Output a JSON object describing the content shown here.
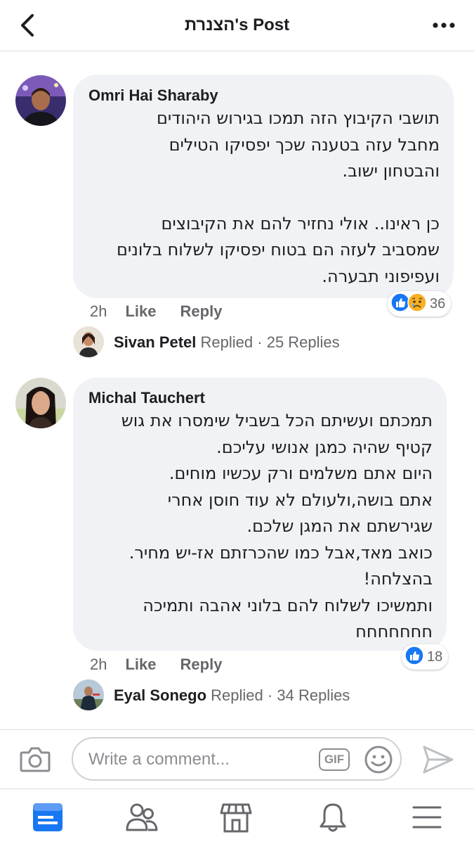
{
  "header": {
    "title": "הצנרת's Post",
    "back_icon": "back-chevron-icon",
    "more_icon": "more-dots-icon"
  },
  "comments": [
    {
      "author": "Omri Hai Sharaby",
      "lines": [
        "תושבי הקיבוץ הזה תמכו בגירוש היהודים",
        "מחבל עזה בטענה שכך יפסיקו הטילים",
        "והבטחון ישוב.",
        "",
        "כן ראינו.. אולי נחזיר להם את הקיבוצים",
        "שמסביב לעזה הם בטוח יפסיקו לשלוח בלונים",
        "ועפיפוני תבערה."
      ],
      "time": "2h",
      "like_label": "Like",
      "reply_label": "Reply",
      "reaction_count": "36",
      "reactions": [
        "like",
        "sad"
      ],
      "reply_preview": {
        "name": "Sivan Petel",
        "replied_label": "Replied",
        "separator": "·",
        "count": "25 Replies"
      }
    },
    {
      "author": "Michal Tauchert",
      "lines": [
        "תמכתם ועשיתם הכל בשביל שימסרו את גוש",
        "קטיף שהיה כמגן אנושי עליכם.",
        "היום אתם משלמים ורק עכשיו מוחים.",
        "אתם בושה,ולעולם לא עוד חוסן אחרי",
        "שגירשתם את המגן שלכם.",
        "כואב מאד,אבל כמו שהכרזתם אז-יש מחיר.",
        "בהצלחה!",
        "ותמשיכו לשלוח להם בלוני אהבה ותמיכה",
        "חחחחחחח"
      ],
      "time": "2h",
      "like_label": "Like",
      "reply_label": "Reply",
      "reaction_count": "18",
      "reactions": [
        "like"
      ],
      "reply_preview": {
        "name": "Eyal Sonego",
        "replied_label": "Replied",
        "separator": "·",
        "count": "34 Replies"
      }
    }
  ],
  "composer": {
    "placeholder": "Write a comment...",
    "gif_label": "GIF"
  },
  "colors": {
    "accent": "#1877f2",
    "bubble": "#f0f2f5",
    "muted": "#65676b",
    "sad_yellow": "#f7b125"
  },
  "bottom_nav": [
    "news-feed-icon",
    "friends-icon",
    "marketplace-icon",
    "notifications-bell-icon",
    "menu-icon"
  ]
}
